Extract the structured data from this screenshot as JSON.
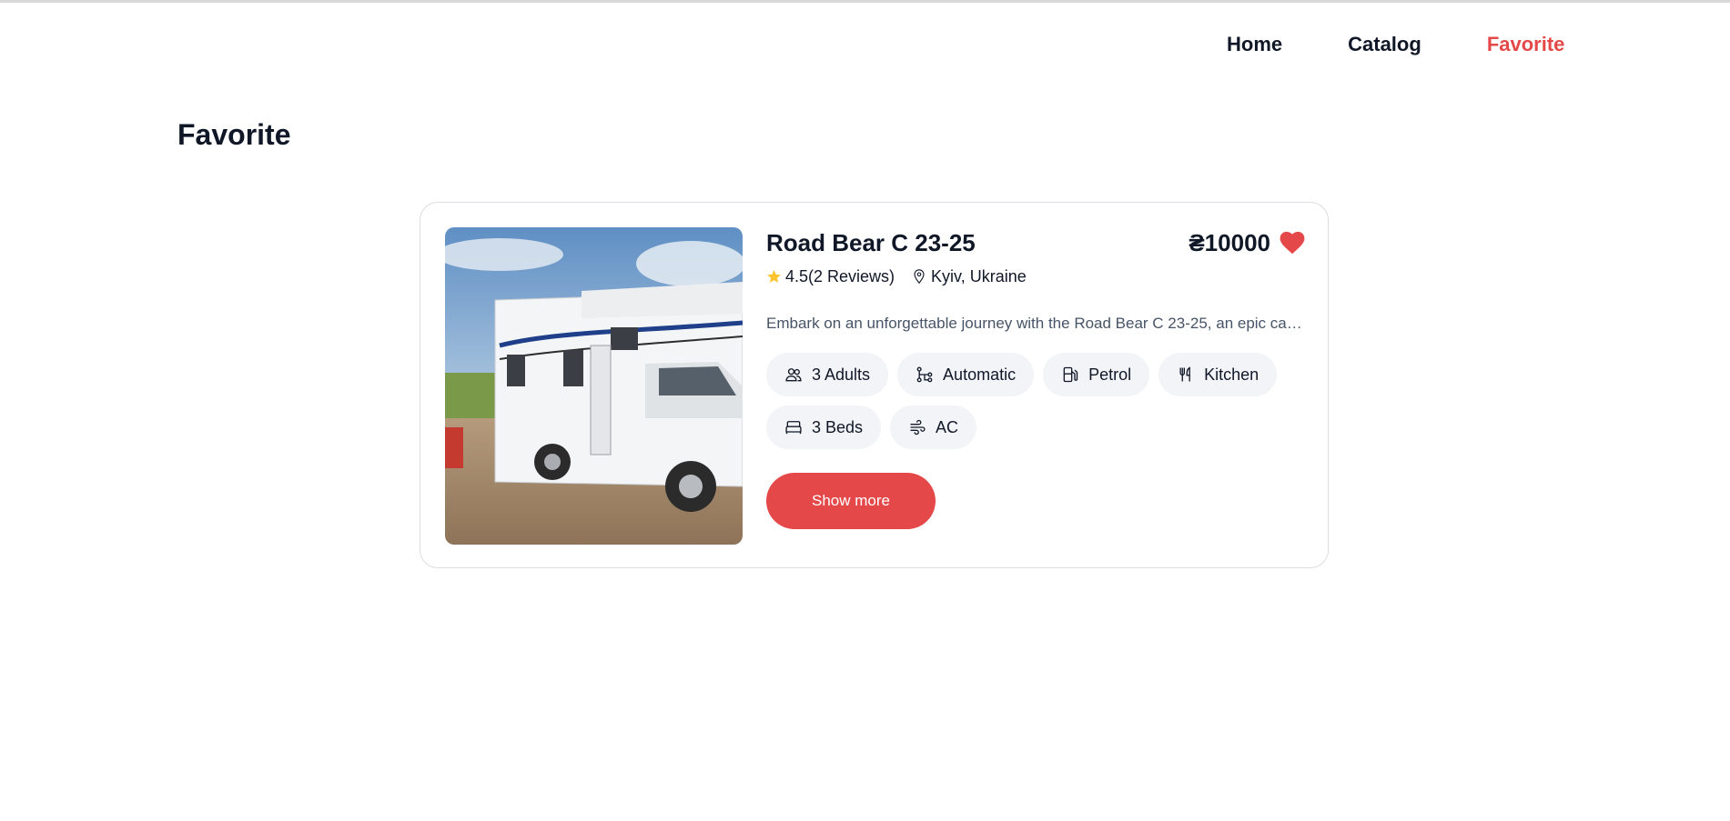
{
  "nav": {
    "home": "Home",
    "catalog": "Catalog",
    "favorite": "Favorite"
  },
  "page": {
    "title": "Favorite"
  },
  "card": {
    "title": "Road Bear C 23-25",
    "price": "₴10000",
    "rating": "4.5(2 Reviews)",
    "location": "Kyiv, Ukraine",
    "description": "Embark on an unforgettable journey with the Road Bear C 23-25, an epic camper for adventurers",
    "features": [
      {
        "label": "3 Adults",
        "icon": "users-icon"
      },
      {
        "label": "Automatic",
        "icon": "transmission-icon"
      },
      {
        "label": "Petrol",
        "icon": "fuel-icon"
      },
      {
        "label": "Kitchen",
        "icon": "kitchen-icon"
      },
      {
        "label": "3 Beds",
        "icon": "bed-icon"
      },
      {
        "label": "AC",
        "icon": "ac-icon"
      }
    ],
    "button": "Show more"
  },
  "colors": {
    "accent": "#e44848",
    "text": "#101828",
    "chip_bg": "#f2f4f7",
    "star": "#ffc531"
  }
}
